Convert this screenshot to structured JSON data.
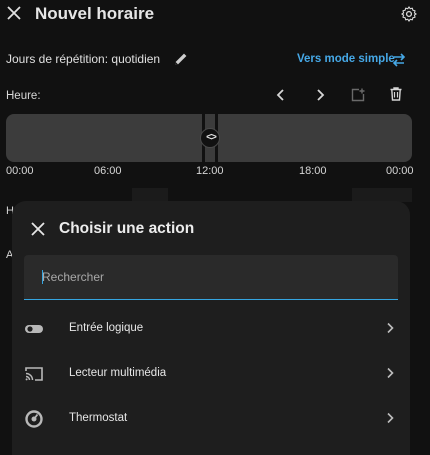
{
  "header": {
    "title": "Nouvel horaire",
    "close_icon": "close-icon",
    "settings_icon": "gear-icon"
  },
  "repeat": {
    "label": "Jours de répétition: quotidien",
    "edit_icon": "pencil-icon"
  },
  "mode_link": {
    "label": "Vers mode simple",
    "icon": "swap-horizontal-icon",
    "color": "#46a8e6"
  },
  "time": {
    "label": "Heure:",
    "toolbar_icons": [
      "chevron-left-icon",
      "chevron-right-icon",
      "add-box-icon",
      "delete-icon"
    ],
    "handle_glyph": "<>",
    "ticks": [
      "00:00",
      "06:00",
      "12:00",
      "18:00",
      "00:00"
    ]
  },
  "background_partial": {
    "letter_h": "H",
    "letter_a": "A"
  },
  "sheet": {
    "title": "Choisir une action",
    "search_placeholder": "Rechercher",
    "accent": "#35a5e0",
    "items": [
      {
        "label": "Entrée logique",
        "icon": "toggle-switch-icon"
      },
      {
        "label": "Lecteur multimédia",
        "icon": "cast-icon"
      },
      {
        "label": "Thermostat",
        "icon": "thermostat-icon"
      }
    ]
  }
}
